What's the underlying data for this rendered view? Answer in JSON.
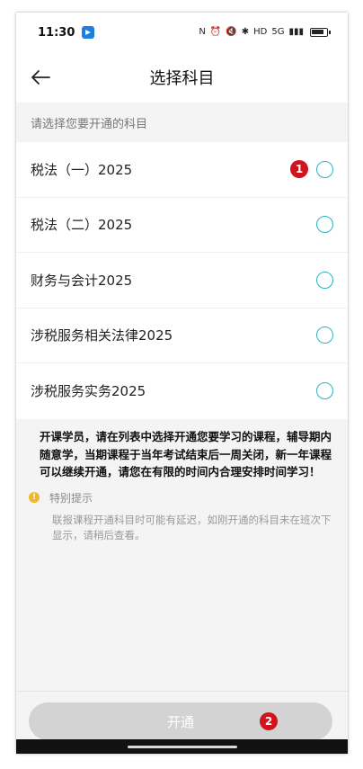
{
  "status_bar": {
    "time": "11:30",
    "right_icons": [
      "N",
      "⏰",
      "🔇",
      "✱",
      "HD",
      "5G"
    ],
    "signal": "▮▮▮"
  },
  "header": {
    "title": "选择科目"
  },
  "section_hint": "请选择您要开通的科目",
  "subjects": [
    {
      "label": "税法（一）2025",
      "selected": false
    },
    {
      "label": "税法（二）2025",
      "selected": false
    },
    {
      "label": "财务与会计2025",
      "selected": false
    },
    {
      "label": "涉税服务相关法律2025",
      "selected": false
    },
    {
      "label": "涉税服务实务2025",
      "selected": false
    }
  ],
  "notice": {
    "text": "开课学员，请在列表中选择开通您要学习的课程，辅导期内随意学，当期课程于当年考试结束后一周关闭，新一年课程可以继续开通，请您在有限的时间内合理安排时间学习！",
    "tip_icon": "!",
    "tip_title": "特别提示",
    "tip_body": "联报课程开通科目时可能有延迟，如刚开通的科目未在班次下显示，请稍后查看。"
  },
  "button": {
    "label": "开通"
  },
  "markers": {
    "m1": "1",
    "m2": "2"
  },
  "colors": {
    "accent_radio": "#2bb4c2",
    "marker": "#d0141d",
    "button_disabled": "#d3d3d3",
    "tip_icon": "#f1b72a"
  }
}
